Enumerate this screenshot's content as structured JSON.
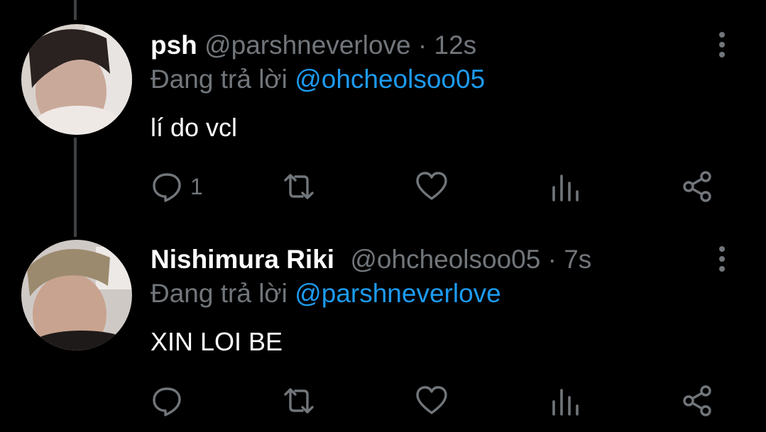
{
  "tweets": [
    {
      "display_name": "psh",
      "handle": "@parshneverlove",
      "separator": "·",
      "time": "12s",
      "replying_prefix": "Đang trả lời",
      "replying_to": "@ohcheolsoo05",
      "text": "lí do vcl",
      "reply_count": "1",
      "icons": [
        "reply-icon",
        "retweet-icon",
        "like-icon",
        "analytics-icon",
        "share-icon",
        "more-vertical-icon"
      ]
    },
    {
      "display_name": "Nishimura Riki",
      "handle": "@ohcheolsoo05",
      "separator": "·",
      "time": "7s",
      "replying_prefix": "Đang trả lời",
      "replying_to": "@parshneverlove",
      "text": "XIN LOI BE",
      "reply_count": "",
      "icons": [
        "reply-icon",
        "retweet-icon",
        "like-icon",
        "analytics-icon",
        "share-icon",
        "more-vertical-icon"
      ]
    }
  ],
  "colors": {
    "background": "#000000",
    "text_primary": "#ffffff",
    "text_secondary": "#71767b",
    "link": "#1d9bf0",
    "thread_line": "#3d4144"
  }
}
